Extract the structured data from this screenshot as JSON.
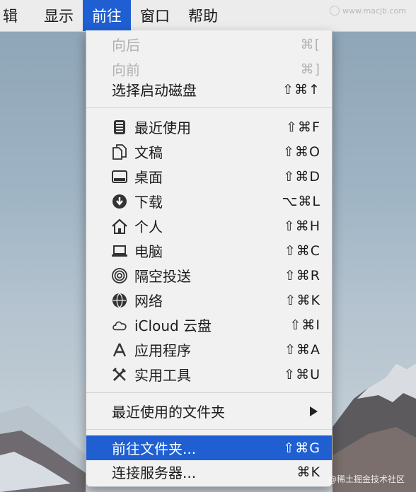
{
  "menubar": {
    "items": [
      {
        "label": "辑",
        "active": false
      },
      {
        "label": "显示",
        "active": false
      },
      {
        "label": "前往",
        "active": true
      },
      {
        "label": "窗口",
        "active": false
      },
      {
        "label": "帮助",
        "active": false
      }
    ],
    "watermark": "www.macjb.com"
  },
  "menu": {
    "items": [
      {
        "label": "向后",
        "shortcut": "⌘[",
        "icon": null,
        "disabled": true
      },
      {
        "label": "向前",
        "shortcut": "⌘]",
        "icon": null,
        "disabled": true
      },
      {
        "label": "选择启动磁盘",
        "shortcut": "⇧⌘↑",
        "icon": null
      },
      {
        "label": "最近使用",
        "shortcut": "⇧⌘F",
        "icon": "recents-icon"
      },
      {
        "label": "文稿",
        "shortcut": "⇧⌘O",
        "icon": "documents-icon"
      },
      {
        "label": "桌面",
        "shortcut": "⇧⌘D",
        "icon": "desktop-icon"
      },
      {
        "label": "下载",
        "shortcut": "⌥⌘L",
        "icon": "downloads-icon"
      },
      {
        "label": "个人",
        "shortcut": "⇧⌘H",
        "icon": "home-icon"
      },
      {
        "label": "电脑",
        "shortcut": "⇧⌘C",
        "icon": "computer-icon"
      },
      {
        "label": "隔空投送",
        "shortcut": "⇧⌘R",
        "icon": "airdrop-icon"
      },
      {
        "label": "网络",
        "shortcut": "⇧⌘K",
        "icon": "network-icon"
      },
      {
        "label": "iCloud 云盘",
        "shortcut": "⇧⌘I",
        "icon": "icloud-icon"
      },
      {
        "label": "应用程序",
        "shortcut": "⇧⌘A",
        "icon": "applications-icon"
      },
      {
        "label": "实用工具",
        "shortcut": "⇧⌘U",
        "icon": "utilities-icon"
      },
      {
        "label": "最近使用的文件夹",
        "shortcut": "",
        "icon": null,
        "submenu": true
      },
      {
        "label": "前往文件夹...",
        "shortcut": "⇧⌘G",
        "icon": null,
        "highlighted": true
      },
      {
        "label": "连接服务器...",
        "shortcut": "⌘K",
        "icon": null
      }
    ]
  },
  "watermark_bottom": "@稀土掘金技术社区",
  "colors": {
    "accent": "#1f5fd1",
    "menu_bg": "#f1f1f1",
    "disabled_text": "#b2b2b2"
  }
}
